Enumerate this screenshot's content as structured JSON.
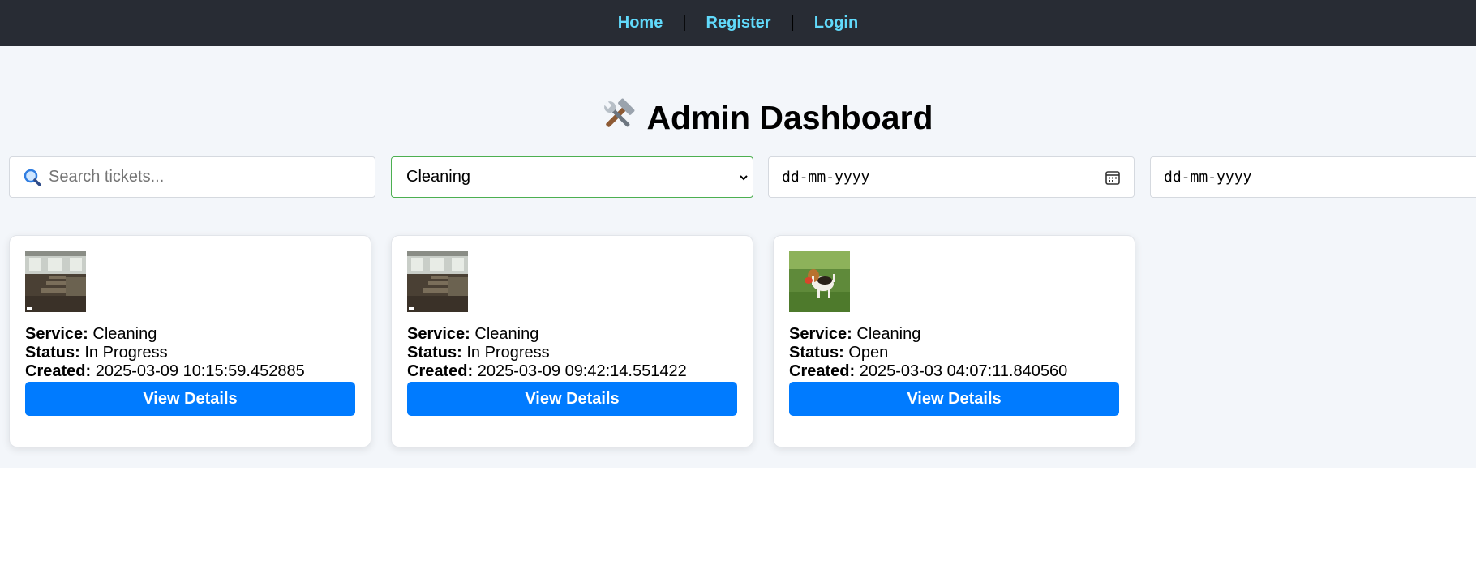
{
  "nav": {
    "items": [
      {
        "label": "Home"
      },
      {
        "label": "Register"
      },
      {
        "label": "Login"
      }
    ],
    "separator": "|"
  },
  "page": {
    "title": "Admin Dashboard",
    "title_icon": "hammer-wrench-icon"
  },
  "filters": {
    "search": {
      "placeholder": "Search tickets...",
      "value": "",
      "icon": "magnifier-icon"
    },
    "service_select": {
      "selected": "Cleaning"
    },
    "date_from": {
      "placeholder": "dd-mm-yyyy"
    },
    "date_to": {
      "placeholder": "dd-mm-yyyy"
    }
  },
  "labels": {
    "service": "Service:",
    "status": "Status:",
    "created": "Created:"
  },
  "tickets": [
    {
      "service": "Cleaning",
      "status": "In Progress",
      "created": "2025-03-09 10:15:59.452885",
      "button": "View Details",
      "thumb": "classroom-photo"
    },
    {
      "service": "Cleaning",
      "status": "In Progress",
      "created": "2025-03-09 09:42:14.551422",
      "button": "View Details",
      "thumb": "classroom-photo"
    },
    {
      "service": "Cleaning",
      "status": "Open",
      "created": "2025-03-03 04:07:11.840560",
      "button": "View Details",
      "thumb": "beagle-dog-photo"
    }
  ],
  "colors": {
    "navbar": "#282c34",
    "nav_link": "#61dafb",
    "accent": "#007bff",
    "select_border": "#4caf50",
    "page_bg": "#f3f6fa"
  }
}
